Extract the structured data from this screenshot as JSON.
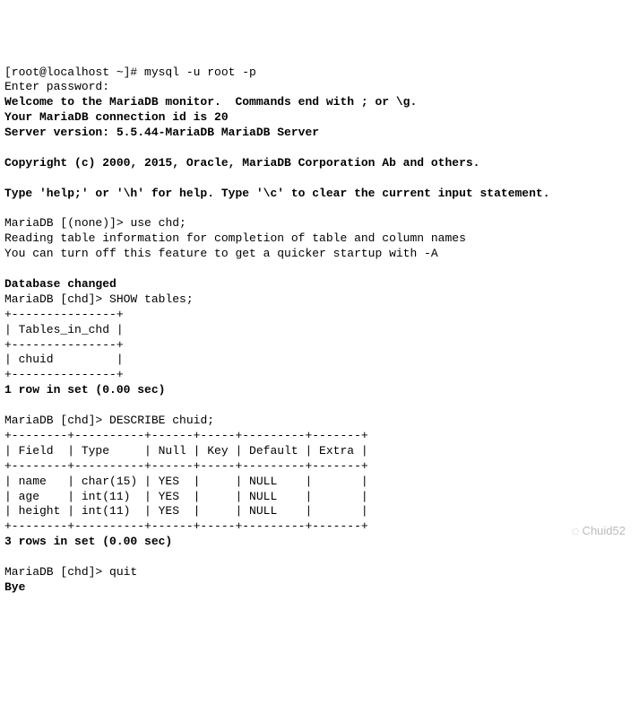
{
  "shell_prompt": "[root@localhost ~]# ",
  "cmd_mysql": "mysql -u root -p",
  "enter_pw": "Enter password:",
  "welcome1": "Welcome to the MariaDB monitor.  Commands end with ; or \\g.",
  "welcome2": "Your MariaDB connection id is 20",
  "welcome3": "Server version: 5.5.44-MariaDB MariaDB Server",
  "copyright": "Copyright (c) 2000, 2015, Oracle, MariaDB Corporation Ab and others.",
  "help_line": "Type 'help;' or '\\h' for help. Type '\\c' to clear the current input statement.",
  "prompt_none": "MariaDB [(none)]> ",
  "cmd_use": "use chd;",
  "reading1": "Reading table information for completion of table and column names",
  "reading2": "You can turn off this feature to get a quicker startup with -A",
  "db_changed": "Database changed",
  "prompt_chd": "MariaDB [chd]> ",
  "cmd_show": "SHOW tables;",
  "t1_border": "+---------------+",
  "t1_header": "| Tables_in_chd |",
  "t1_row1": "| chuid         |",
  "result1": "1 row in set (0.00 sec)",
  "cmd_describe": "DESCRIBE chuid;",
  "t2_border": "+--------+----------+------+-----+---------+-------+",
  "t2_header": "| Field  | Type     | Null | Key | Default | Extra |",
  "t2_row1": "| name   | char(15) | YES  |     | NULL    |       |",
  "t2_row2": "| age    | int(11)  | YES  |     | NULL    |       |",
  "t2_row3": "| height | int(11)  | YES  |     | NULL    |       |",
  "result2": "3 rows in set (0.00 sec)",
  "cmd_quit": "quit",
  "bye": "Bye",
  "watermark": "Chuid52",
  "chart_data": {
    "type": "table",
    "tables": [
      {
        "title": "Tables_in_chd",
        "columns": [
          "Tables_in_chd"
        ],
        "rows": [
          [
            "chuid"
          ]
        ]
      },
      {
        "title": "DESCRIBE chuid",
        "columns": [
          "Field",
          "Type",
          "Null",
          "Key",
          "Default",
          "Extra"
        ],
        "rows": [
          [
            "name",
            "char(15)",
            "YES",
            "",
            "NULL",
            ""
          ],
          [
            "age",
            "int(11)",
            "YES",
            "",
            "NULL",
            ""
          ],
          [
            "height",
            "int(11)",
            "YES",
            "",
            "NULL",
            ""
          ]
        ]
      }
    ]
  }
}
